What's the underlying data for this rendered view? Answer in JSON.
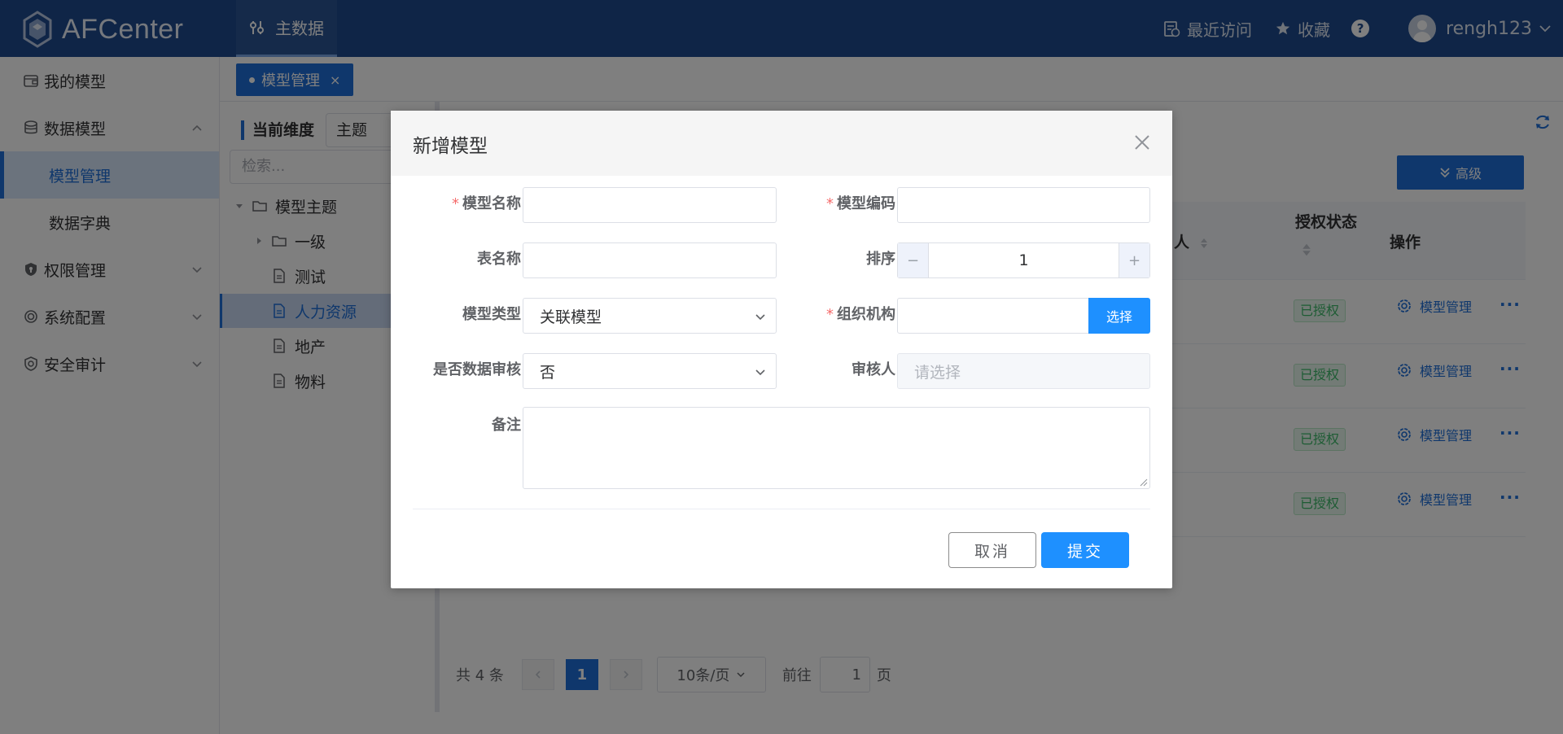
{
  "header": {
    "logo_text": "AFCenter",
    "nav_item": "主数据",
    "recent_label": "最近访问",
    "favorite_label": "收藏",
    "help_symbol": "?",
    "user_name": "rengh123"
  },
  "sidebar": {
    "items": [
      {
        "label": "我的模型"
      },
      {
        "label": "数据模型"
      },
      {
        "label": "模型管理"
      },
      {
        "label": "数据字典"
      },
      {
        "label": "权限管理"
      },
      {
        "label": "系统配置"
      },
      {
        "label": "安全审计"
      }
    ]
  },
  "tabs": {
    "active_tab": "模型管理",
    "close_symbol": "×"
  },
  "tree_panel": {
    "dimension_label": "当前维度",
    "dimension_value": "主题",
    "search_placeholder": "检索...",
    "nodes": [
      {
        "label": "模型主题"
      },
      {
        "label": "一级"
      },
      {
        "label": "测试"
      },
      {
        "label": "人力资源"
      },
      {
        "label": "地产"
      },
      {
        "label": "物料"
      }
    ]
  },
  "content": {
    "advanced_button": "高级",
    "columns": {
      "person_partial": "人",
      "auth_status": "授权状态",
      "operations": "操作"
    },
    "rows": [
      {
        "status": "已授权",
        "action": "模型管理",
        "more": "···"
      },
      {
        "status": "已授权",
        "action": "模型管理",
        "more": "···"
      },
      {
        "status": "已授权",
        "action": "模型管理",
        "more": "···"
      },
      {
        "status": "已授权",
        "action": "模型管理",
        "more": "···"
      }
    ],
    "pagination": {
      "total": "共 4 条",
      "current_page": "1",
      "page_size": "10条/页",
      "goto_label": "前往",
      "goto_value": "1",
      "page_suffix": "页"
    }
  },
  "dialog": {
    "title": "新增模型",
    "required_mark": "*",
    "fields": {
      "model_name": {
        "label": "模型名称",
        "value": ""
      },
      "model_code": {
        "label": "模型编码",
        "value": ""
      },
      "table_name": {
        "label": "表名称",
        "value": ""
      },
      "sort": {
        "label": "排序",
        "value": "1",
        "minus": "−",
        "plus": "+"
      },
      "model_type": {
        "label": "模型类型",
        "value": "关联模型"
      },
      "org": {
        "label": "组织机构",
        "value": "",
        "button": "选择"
      },
      "data_audit": {
        "label": "是否数据审核",
        "value": "否"
      },
      "auditor": {
        "label": "审核人",
        "placeholder": "请选择"
      },
      "remark": {
        "label": "备注",
        "value": ""
      }
    },
    "cancel_label": "取消",
    "submit_label": "提交"
  },
  "colors": {
    "header_bg": "#1e4b8f",
    "accent": "#1e6fd9",
    "primary_button": "#1e90ff",
    "success": "#3db868",
    "required": "#f56c6c"
  },
  "icons": [
    "logo-icon",
    "dashboard-icon",
    "history-icon",
    "star-icon",
    "help-icon",
    "avatar",
    "chevron-down-icon",
    "wallet-icon",
    "database-icon",
    "shield-icon",
    "settings-icon",
    "audit-shield-icon",
    "folder-icon",
    "document-icon",
    "refresh-icon",
    "double-chevron-down-icon",
    "gear-icon",
    "close-icon"
  ]
}
